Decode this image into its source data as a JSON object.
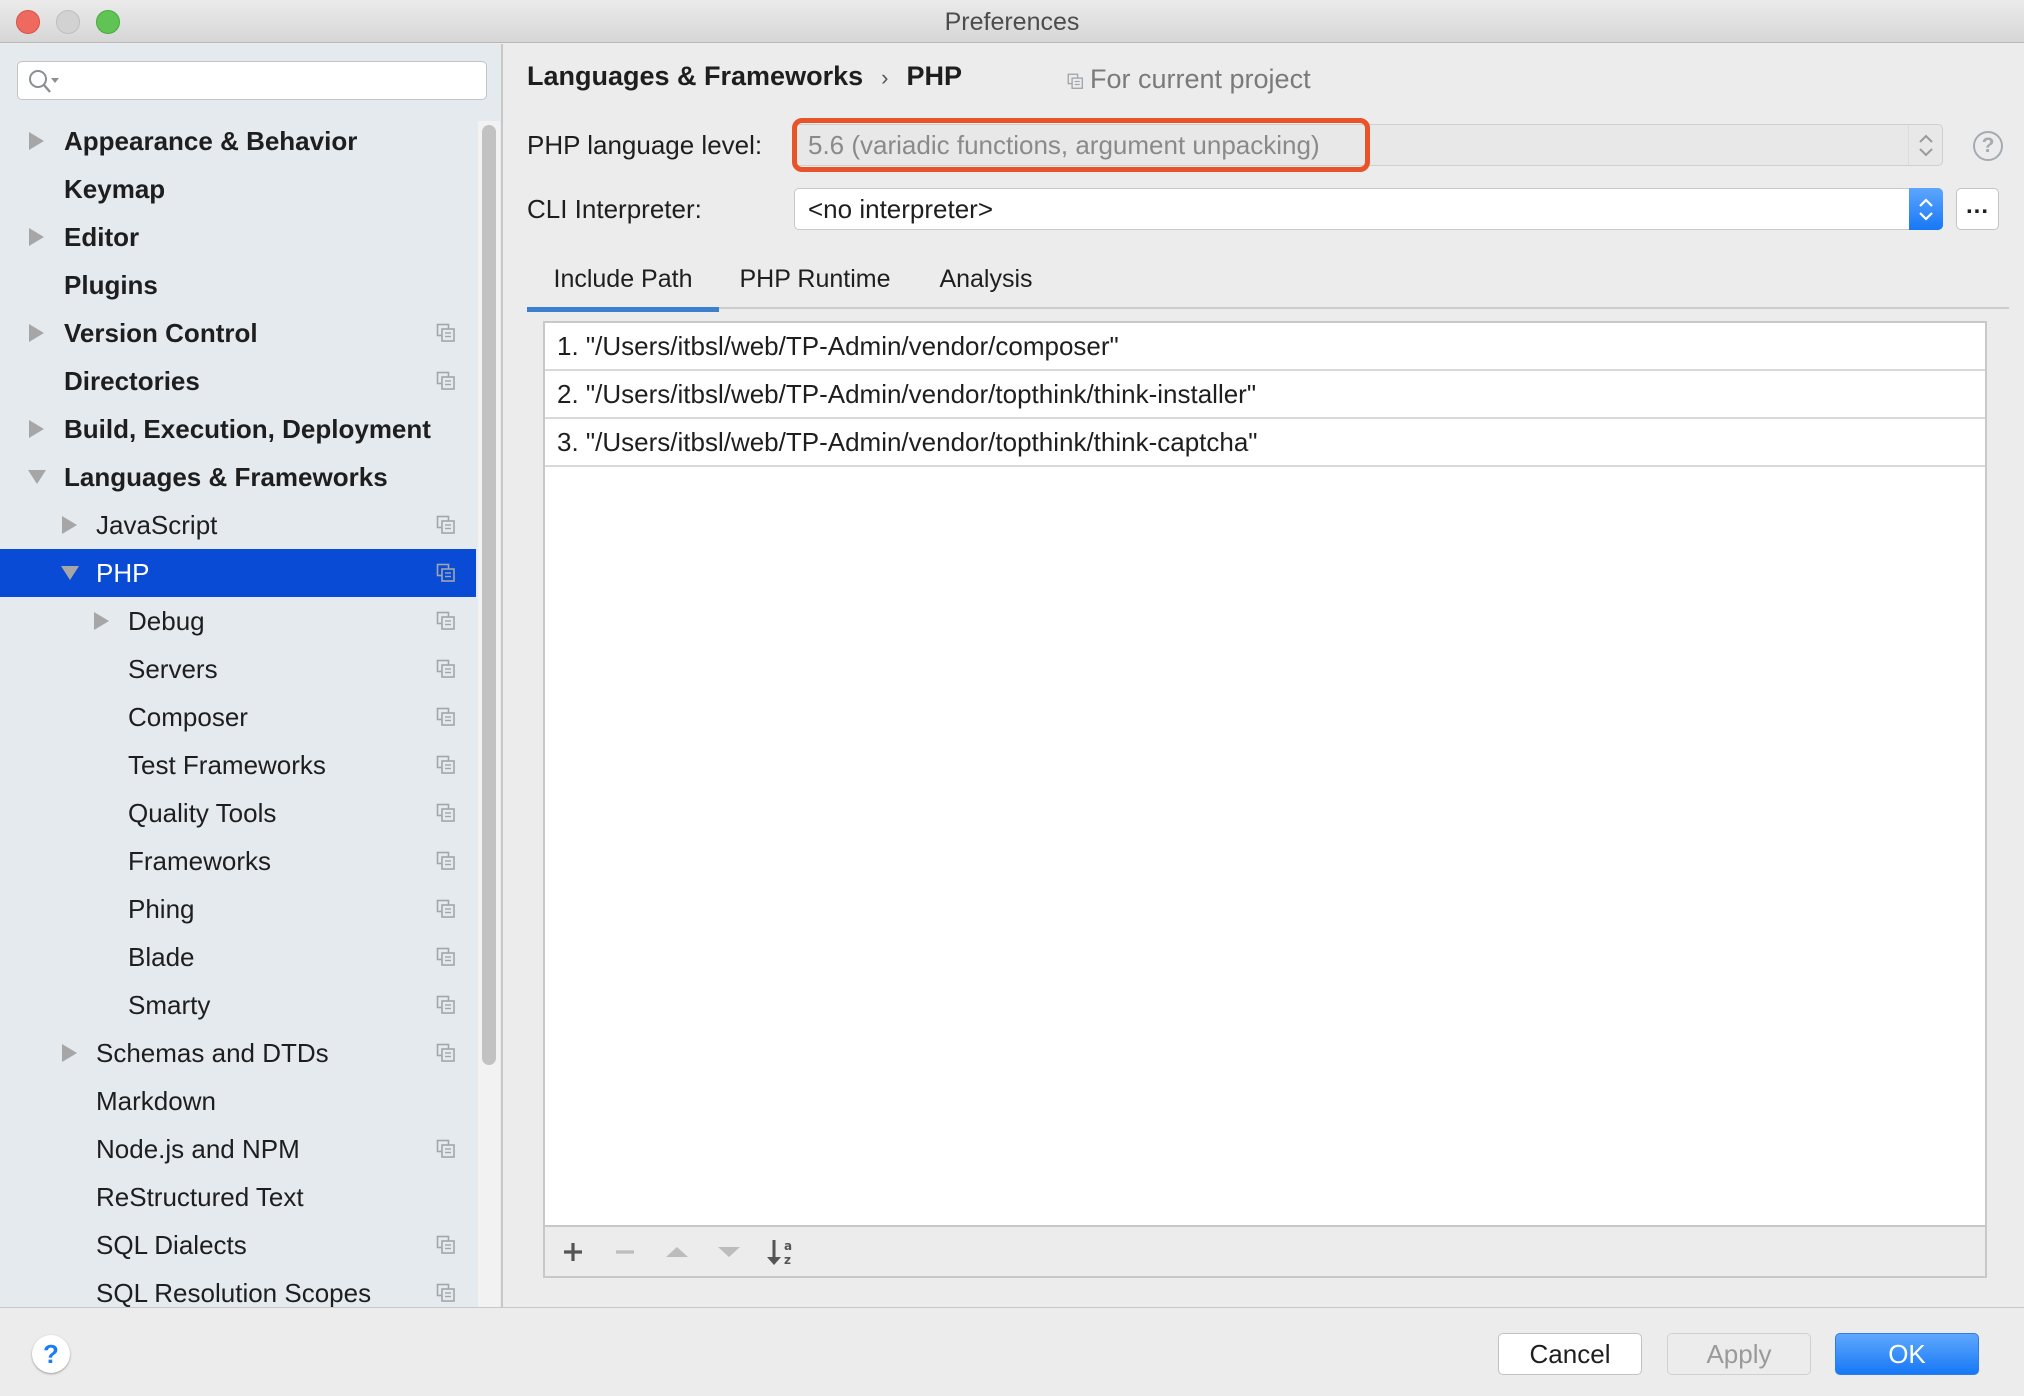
{
  "window": {
    "title": "Preferences"
  },
  "sidebar": {
    "search": {
      "value": "",
      "placeholder": ""
    },
    "items": [
      {
        "label": "Appearance & Behavior",
        "level": 0,
        "bold": true,
        "expander": "collapsed",
        "project_icon": false,
        "selected": false
      },
      {
        "label": "Keymap",
        "level": 0,
        "bold": true,
        "expander": "none",
        "project_icon": false,
        "selected": false
      },
      {
        "label": "Editor",
        "level": 0,
        "bold": true,
        "expander": "collapsed",
        "project_icon": false,
        "selected": false
      },
      {
        "label": "Plugins",
        "level": 0,
        "bold": true,
        "expander": "none",
        "project_icon": false,
        "selected": false
      },
      {
        "label": "Version Control",
        "level": 0,
        "bold": true,
        "expander": "collapsed",
        "project_icon": true,
        "selected": false
      },
      {
        "label": "Directories",
        "level": 0,
        "bold": true,
        "expander": "none",
        "project_icon": true,
        "selected": false
      },
      {
        "label": "Build, Execution, Deployment",
        "level": 0,
        "bold": true,
        "expander": "collapsed",
        "project_icon": false,
        "selected": false
      },
      {
        "label": "Languages & Frameworks",
        "level": 0,
        "bold": true,
        "expander": "expanded",
        "project_icon": false,
        "selected": false
      },
      {
        "label": "JavaScript",
        "level": 1,
        "bold": false,
        "expander": "collapsed",
        "project_icon": true,
        "selected": false
      },
      {
        "label": "PHP",
        "level": 1,
        "bold": false,
        "expander": "expanded",
        "project_icon": true,
        "selected": true
      },
      {
        "label": "Debug",
        "level": 2,
        "bold": false,
        "expander": "collapsed",
        "project_icon": true,
        "selected": false
      },
      {
        "label": "Servers",
        "level": 2,
        "bold": false,
        "expander": "none",
        "project_icon": true,
        "selected": false
      },
      {
        "label": "Composer",
        "level": 2,
        "bold": false,
        "expander": "none",
        "project_icon": true,
        "selected": false
      },
      {
        "label": "Test Frameworks",
        "level": 2,
        "bold": false,
        "expander": "none",
        "project_icon": true,
        "selected": false
      },
      {
        "label": "Quality Tools",
        "level": 2,
        "bold": false,
        "expander": "none",
        "project_icon": true,
        "selected": false
      },
      {
        "label": "Frameworks",
        "level": 2,
        "bold": false,
        "expander": "none",
        "project_icon": true,
        "selected": false
      },
      {
        "label": "Phing",
        "level": 2,
        "bold": false,
        "expander": "none",
        "project_icon": true,
        "selected": false
      },
      {
        "label": "Blade",
        "level": 2,
        "bold": false,
        "expander": "none",
        "project_icon": true,
        "selected": false
      },
      {
        "label": "Smarty",
        "level": 2,
        "bold": false,
        "expander": "none",
        "project_icon": true,
        "selected": false
      },
      {
        "label": "Schemas and DTDs",
        "level": 1,
        "bold": false,
        "expander": "collapsed",
        "project_icon": true,
        "selected": false
      },
      {
        "label": "Markdown",
        "level": 1,
        "bold": false,
        "expander": "none",
        "project_icon": false,
        "selected": false
      },
      {
        "label": "Node.js and NPM",
        "level": 1,
        "bold": false,
        "expander": "none",
        "project_icon": true,
        "selected": false
      },
      {
        "label": "ReStructured Text",
        "level": 1,
        "bold": false,
        "expander": "none",
        "project_icon": false,
        "selected": false
      },
      {
        "label": "SQL Dialects",
        "level": 1,
        "bold": false,
        "expander": "none",
        "project_icon": true,
        "selected": false
      },
      {
        "label": "SQL Resolution Scopes",
        "level": 1,
        "bold": false,
        "expander": "none",
        "project_icon": true,
        "selected": false
      }
    ]
  },
  "main": {
    "breadcrumb": {
      "parent": "Languages & Frameworks",
      "separator": "›",
      "current": "PHP"
    },
    "scope_label": "For current project",
    "language_level": {
      "label": "PHP language level:",
      "value": "5.6 (variadic functions, argument unpacking)",
      "highlight_color": "#e9532a"
    },
    "cli_interpreter": {
      "label": "CLI Interpreter:",
      "value": "<no interpreter>",
      "more_button": "..."
    },
    "help_icon": "?",
    "tabs": [
      {
        "label": "Include Path",
        "active": true
      },
      {
        "label": "PHP Runtime",
        "active": false
      },
      {
        "label": "Analysis",
        "active": false
      }
    ],
    "include_paths": [
      "1. \"/Users/itbsl/web/TP-Admin/vendor/composer\"",
      "2. \"/Users/itbsl/web/TP-Admin/vendor/topthink/think-installer\"",
      "3. \"/Users/itbsl/web/TP-Admin/vendor/topthink/think-captcha\""
    ],
    "toolbar": [
      {
        "icon": "plus-icon",
        "enabled": true
      },
      {
        "icon": "minus-icon",
        "enabled": false
      },
      {
        "icon": "move-up-icon",
        "enabled": false
      },
      {
        "icon": "move-down-icon",
        "enabled": false
      },
      {
        "icon": "sort-alphabetically-icon",
        "enabled": true
      }
    ]
  },
  "footer": {
    "help": "?",
    "cancel": "Cancel",
    "apply": "Apply",
    "ok": "OK",
    "accent_color": "#1778f6"
  }
}
